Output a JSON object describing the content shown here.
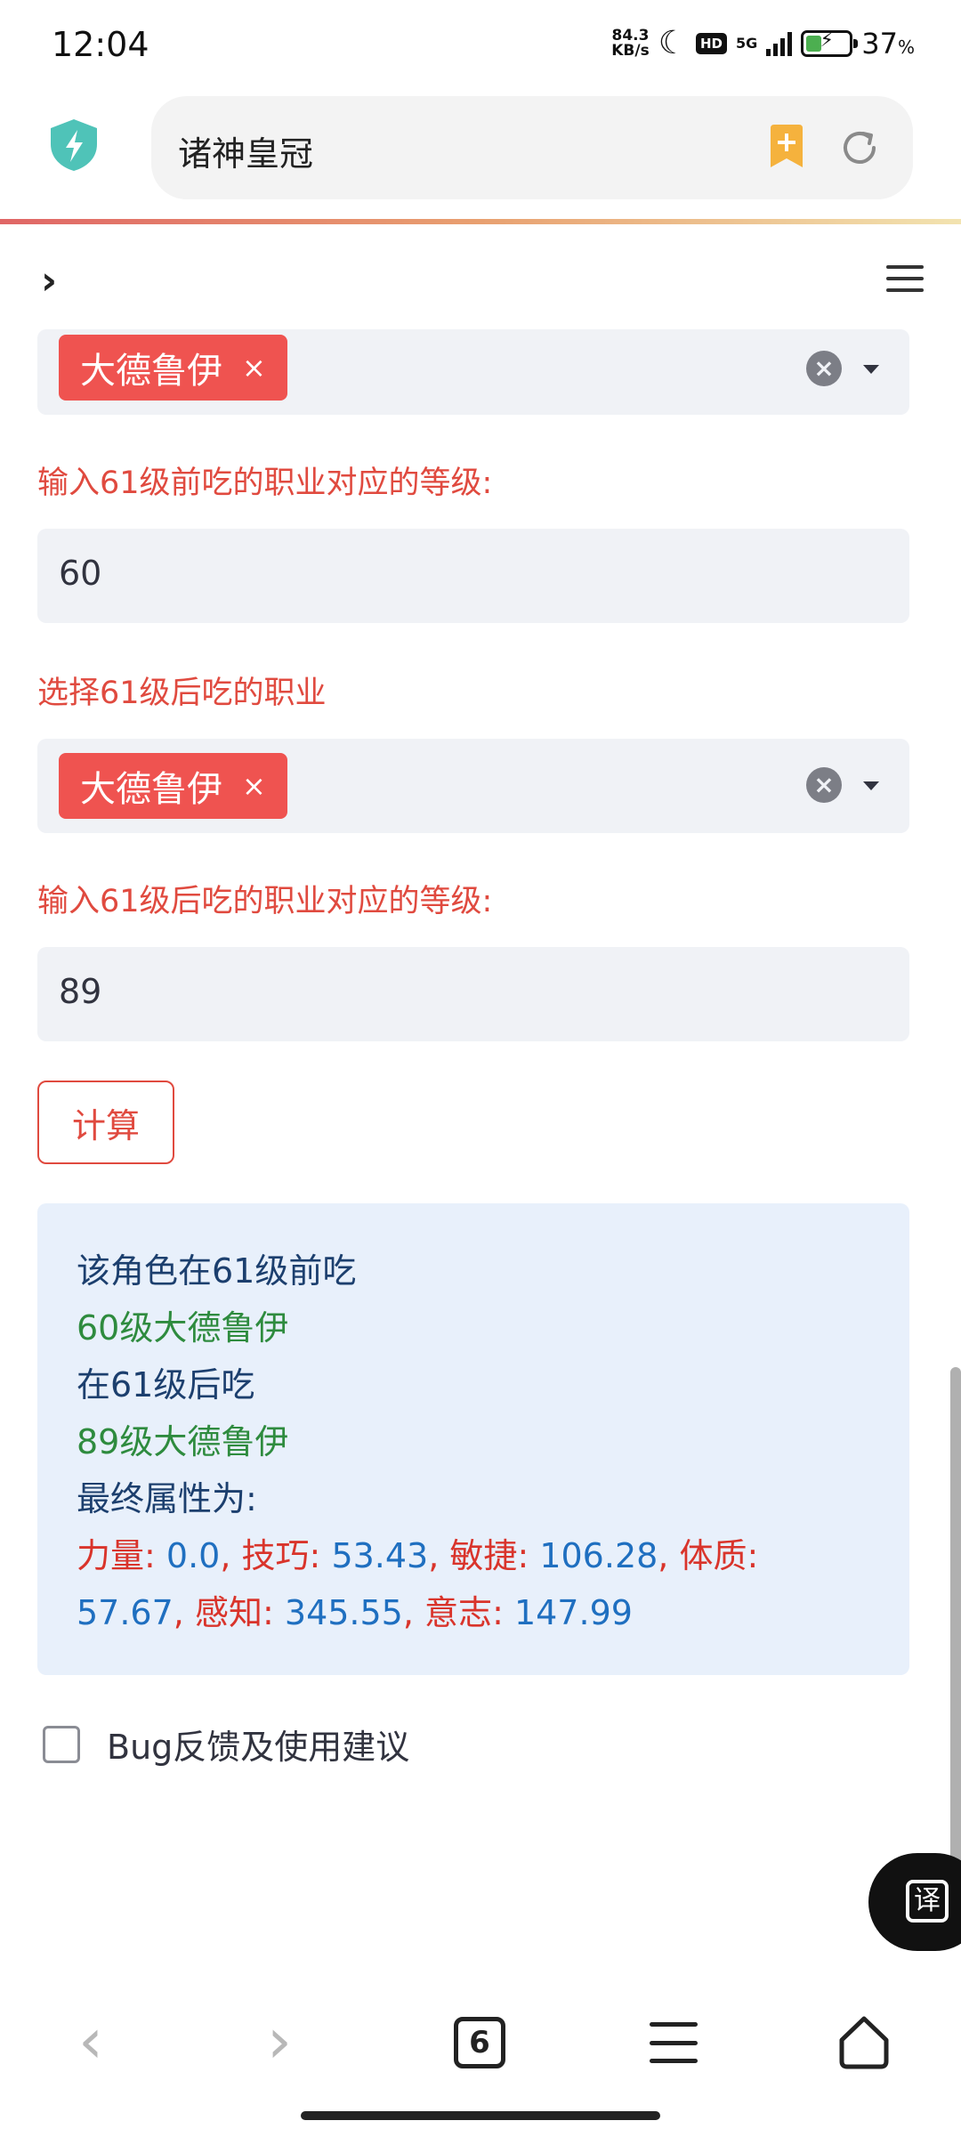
{
  "status_bar": {
    "time": "12:04",
    "net_speed_value": "84.3",
    "net_speed_unit": "KB/s",
    "hd": "HD",
    "net_type": "5G",
    "battery_percent": "37",
    "battery_unit": "%",
    "battery_level": 0.37
  },
  "browser": {
    "address_text": "诸神皇冠"
  },
  "form": {
    "first_class_tag": "大德鲁伊",
    "tag_close": "×",
    "clear": "×",
    "before_level_label": "输入61级前吃的职业对应的等级:",
    "before_level_value": "60",
    "after_class_label": "选择61级后吃的职业",
    "second_class_tag": "大德鲁伊",
    "after_level_label": "输入61级后吃的职业对应的等级:",
    "after_level_value": "89",
    "calc_button": "计算"
  },
  "result": {
    "line1": "该角色在61级前吃",
    "line2_num": "60",
    "line2_text": "级大德鲁伊",
    "line3": "在61级后吃",
    "line4_num": "89",
    "line4_text": "级大德鲁伊",
    "line5": "最终属性为:",
    "stats": [
      {
        "name": "力量",
        "sep": ": ",
        "value": "0.0",
        "end": ","
      },
      {
        "name": "技巧",
        "sep": ": ",
        "value": "53.43",
        "end": ","
      },
      {
        "name": "敏捷",
        "sep": ": ",
        "value": "106.28",
        "end": ","
      },
      {
        "name": "体质",
        "sep": ": ",
        "value": "57.67",
        "end": ","
      },
      {
        "name": "感知",
        "sep": ": ",
        "value": "345.55",
        "end": ","
      },
      {
        "name": "意志",
        "sep": ": ",
        "value": "147.99",
        "end": ""
      }
    ]
  },
  "feedback": {
    "label": "Bug反馈及使用建议",
    "checked": false
  },
  "fab": {
    "translate_glyph": "译"
  },
  "bottom_nav": {
    "back": "‹",
    "forward": "›",
    "tab_count": "6"
  },
  "colors": {
    "accent_red": "#e04a3f",
    "tag_red": "#ef5350",
    "result_bg": "#e8f0fb",
    "green_text": "#2e8b3e",
    "blue_text": "#1f6fc0"
  }
}
